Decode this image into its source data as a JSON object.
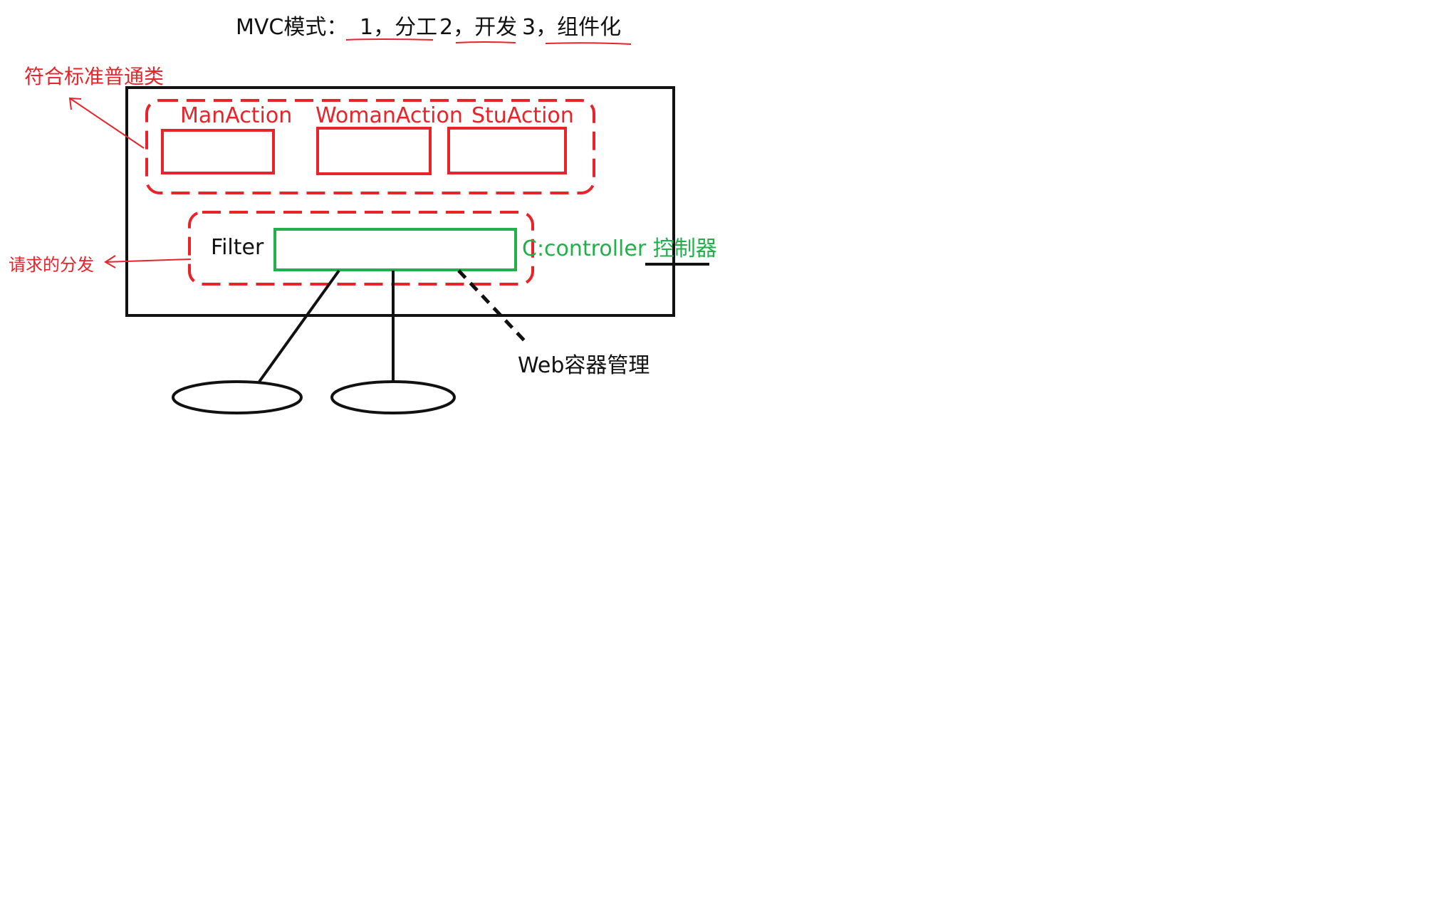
{
  "title": {
    "prefix": "MVC模式：",
    "items": [
      "1，分工",
      "2，开发",
      "3，组件化"
    ]
  },
  "annotations": {
    "standard_class": "符合标准普通类",
    "request_dispatch": "请求的分发",
    "web_container": "Web容器管理"
  },
  "actions": [
    "ManAction",
    "WomanAction",
    "StuAction"
  ],
  "filter": {
    "label": "Filter",
    "controller": "C:controller 控制器"
  },
  "colors": {
    "ink": "#111111",
    "red": "#e8232a",
    "green": "#22b04b"
  }
}
